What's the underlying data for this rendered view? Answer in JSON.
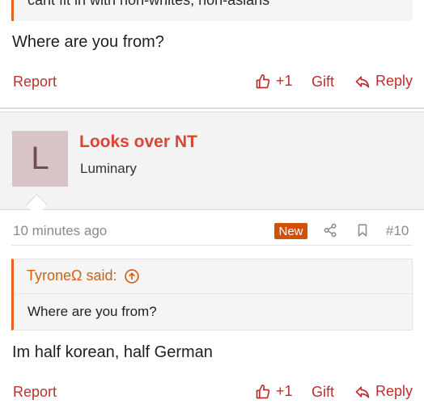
{
  "prev_post": {
    "quote_text": "cant fit in with non-whites, non-asians",
    "message": "Where are you from?",
    "actions": {
      "report": "Report",
      "like_count": "+1",
      "gift": "Gift",
      "reply": "Reply"
    }
  },
  "post": {
    "avatar_letter": "L",
    "author": "Looks over NT",
    "rank": "Luminary",
    "time": "10 minutes ago",
    "badge": "New",
    "number": "#10",
    "quote": {
      "author": "TyroneΩ said:",
      "text": "Where are you from?"
    },
    "message": "Im half korean, half German",
    "actions": {
      "report": "Report",
      "like_count": "+1",
      "gift": "Gift",
      "reply": "Reply"
    }
  },
  "colors": {
    "accent_red": "#b8312f",
    "author_red": "#dd4434",
    "quote_orange": "#e8621f",
    "badge": "#d34f0c"
  },
  "icons": [
    "thumbs-up-icon",
    "reply-icon",
    "share-icon",
    "bookmark-icon",
    "arrow-up-circle-icon"
  ]
}
